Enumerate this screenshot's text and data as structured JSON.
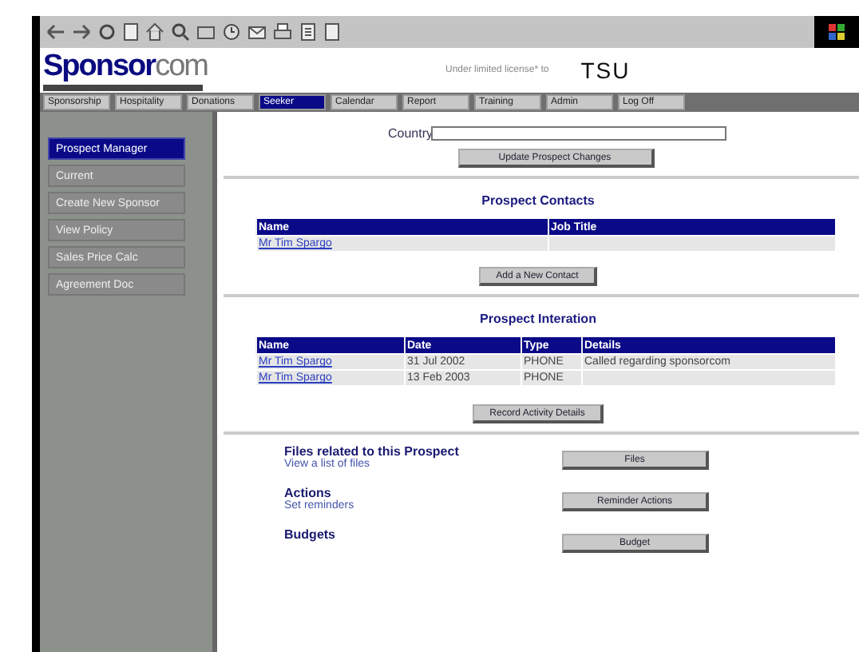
{
  "logo": {
    "main": "Sponsor",
    "accent": "com"
  },
  "license": {
    "text": "Under limited license* to",
    "holder": "TSU"
  },
  "nav": [
    {
      "label": "Sponsorship",
      "selected": false
    },
    {
      "label": "Hospitality",
      "selected": false
    },
    {
      "label": "Donations",
      "selected": false
    },
    {
      "label": "Seeker",
      "selected": true
    },
    {
      "label": "Calendar",
      "selected": false
    },
    {
      "label": "Report",
      "selected": false
    },
    {
      "label": "Training",
      "selected": false
    },
    {
      "label": "Admin",
      "selected": false
    },
    {
      "label": "Log Off",
      "selected": false
    }
  ],
  "sidebar": {
    "items": [
      {
        "label": "Prospect Manager",
        "selected": true
      },
      {
        "label": "Current",
        "selected": false
      },
      {
        "label": "Create New Sponsor",
        "selected": false
      },
      {
        "label": "View Policy",
        "selected": false
      },
      {
        "label": "Sales Price Calc",
        "selected": false
      },
      {
        "label": "Agreement Doc",
        "selected": false
      }
    ]
  },
  "form": {
    "country_label": "Country",
    "update_button": "Update Prospect Changes"
  },
  "contacts": {
    "title": "Prospect Contacts",
    "columns": [
      "Name",
      "Job Title"
    ],
    "rows": [
      [
        "Mr Tim Spargo",
        ""
      ]
    ],
    "button": "Add a New Contact"
  },
  "interaction": {
    "title": "Prospect Interation",
    "columns": [
      "Name",
      "Date",
      "Type",
      "Details"
    ],
    "rows": [
      [
        "Mr Tim Spargo",
        "31 Jul 2002",
        "PHONE",
        "Called regarding sponsorcom"
      ],
      [
        "Mr Tim Spargo",
        "13 Feb 2003",
        "PHONE",
        ""
      ]
    ],
    "button": "Record Activity Details"
  },
  "links": [
    {
      "title": "Files related to this Prospect",
      "subtitle": "View a list of files",
      "button": "Files"
    },
    {
      "title": "Actions",
      "subtitle": "Set reminders",
      "button": "Reminder Actions"
    },
    {
      "title": "Budgets",
      "button": "Budget"
    }
  ]
}
